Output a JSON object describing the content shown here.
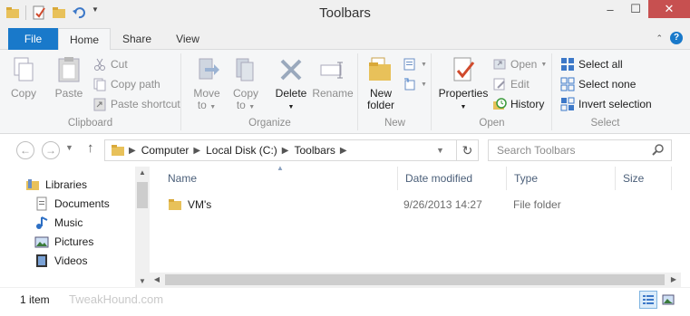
{
  "window": {
    "title": "Toolbars"
  },
  "ribbon_tabs": {
    "file": "File",
    "home": "Home",
    "share": "Share",
    "view": "View"
  },
  "ribbon": {
    "clipboard": {
      "label": "Clipboard",
      "copy": "Copy",
      "paste": "Paste",
      "cut": "Cut",
      "copy_path": "Copy path",
      "paste_shortcut": "Paste shortcut"
    },
    "organize": {
      "label": "Organize",
      "move_to_1": "Move",
      "move_to_2": "to",
      "copy_to_1": "Copy",
      "copy_to_2": "to",
      "delete": "Delete",
      "rename": "Rename"
    },
    "new": {
      "label": "New",
      "new_folder_1": "New",
      "new_folder_2": "folder"
    },
    "open": {
      "label": "Open",
      "properties": "Properties",
      "open": "Open",
      "edit": "Edit",
      "history": "History"
    },
    "select": {
      "label": "Select",
      "select_all": "Select all",
      "select_none": "Select none",
      "invert_selection": "Invert selection"
    }
  },
  "address": {
    "crumbs": [
      "Computer",
      "Local Disk (C:)",
      "Toolbars"
    ],
    "search_placeholder": "Search Toolbars"
  },
  "navpane": {
    "items": [
      {
        "label": "Libraries",
        "icon": "libraries-icon"
      },
      {
        "label": "Documents",
        "icon": "documents-icon"
      },
      {
        "label": "Music",
        "icon": "music-icon"
      },
      {
        "label": "Pictures",
        "icon": "pictures-icon"
      },
      {
        "label": "Videos",
        "icon": "videos-icon"
      }
    ]
  },
  "columns": {
    "name": "Name",
    "date_modified": "Date modified",
    "type": "Type",
    "size": "Size"
  },
  "files": [
    {
      "name": "VM's",
      "date_modified": "9/26/2013 14:27",
      "type": "File folder",
      "size": ""
    }
  ],
  "status": {
    "item_count": "1 item",
    "watermark": "TweakHound.com"
  },
  "colors": {
    "file_tab": "#1979ca",
    "close_button": "#c75050",
    "folder_yellow": "#e8c15a"
  }
}
